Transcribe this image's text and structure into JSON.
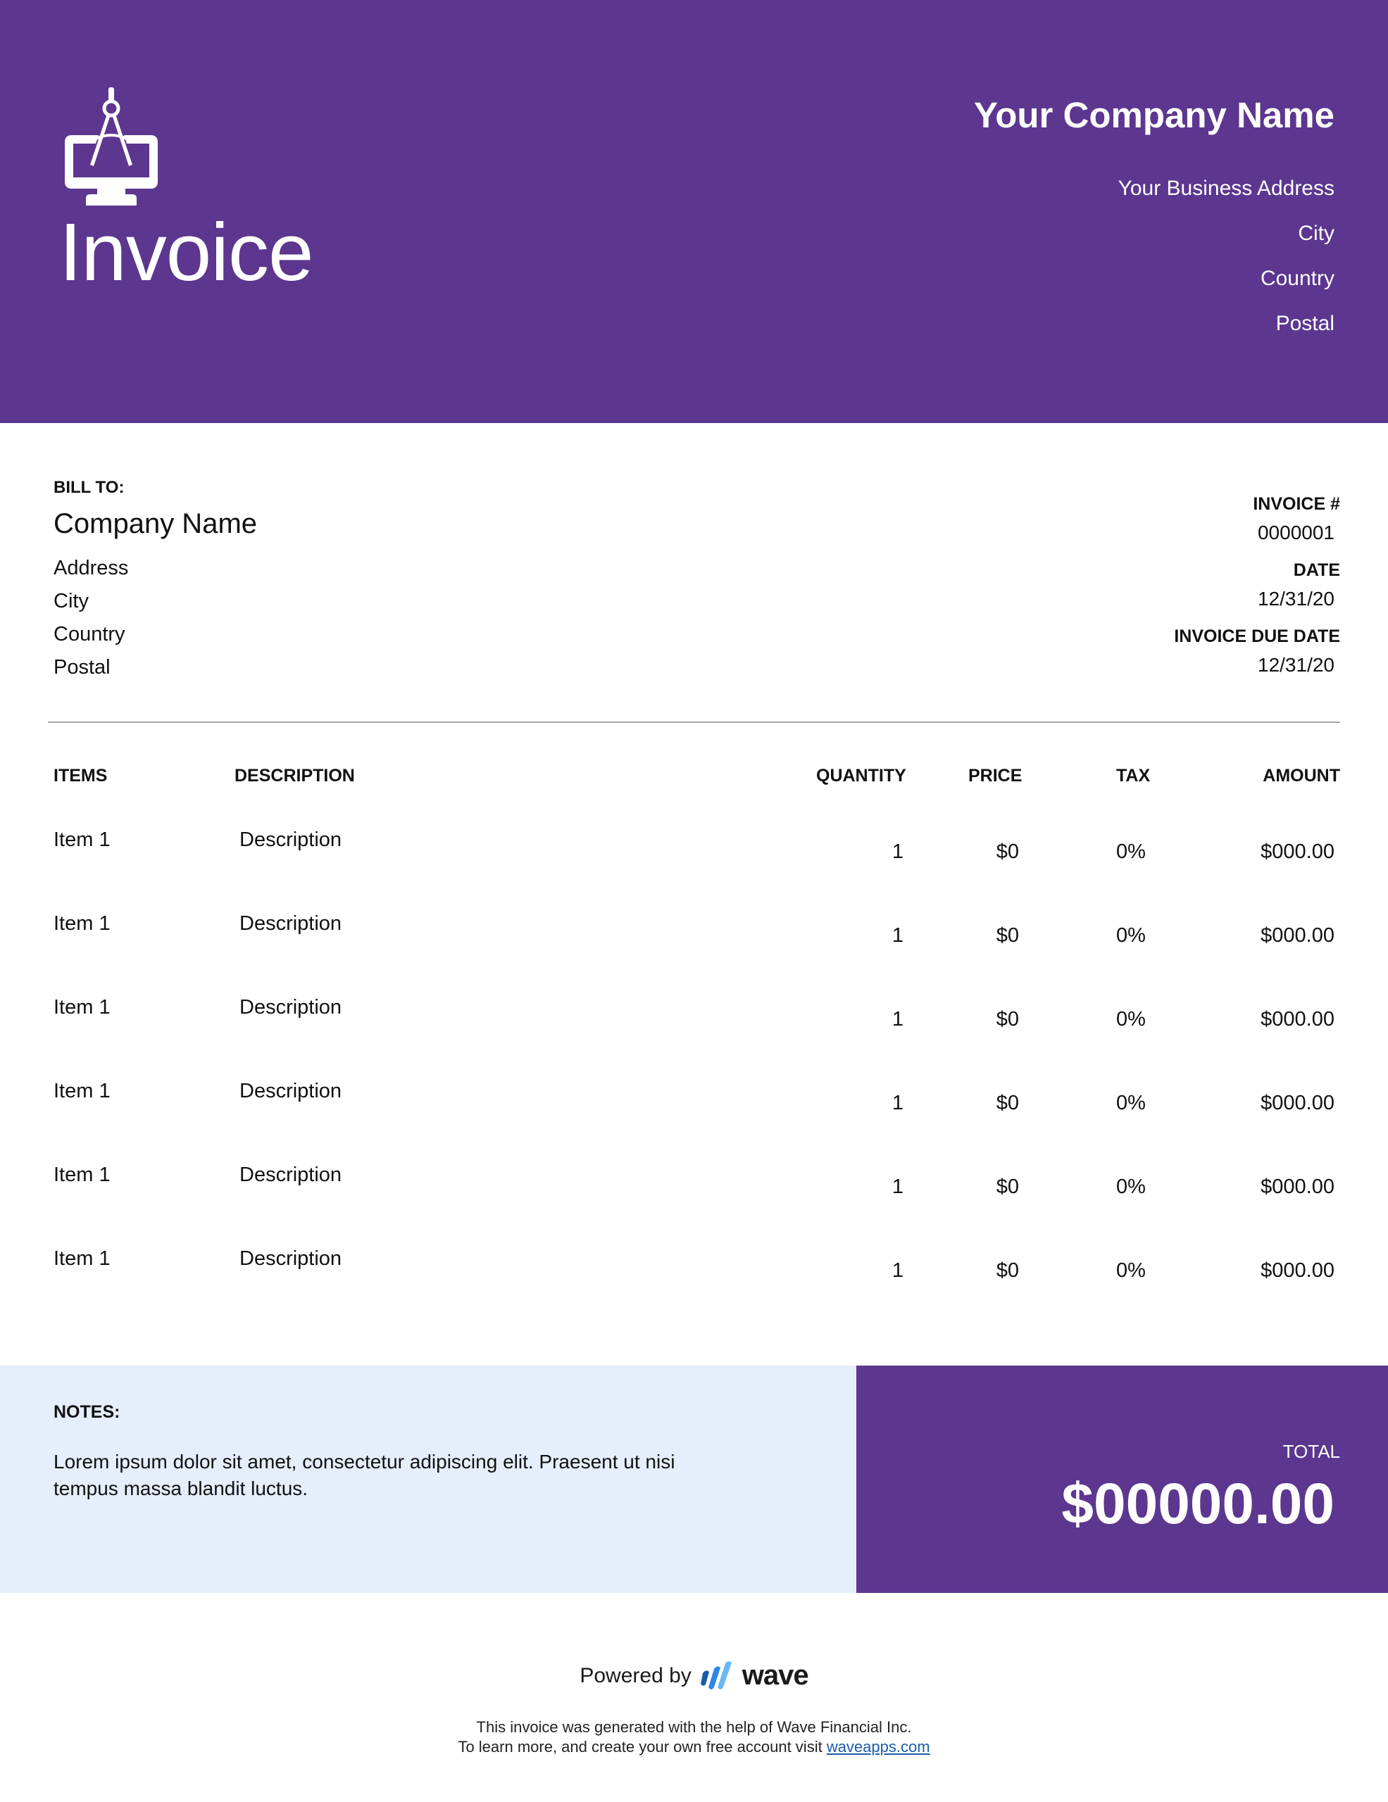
{
  "colors": {
    "brand_purple": "#5c368f",
    "notes_background": "#e6eefc",
    "link": "#1b5cad",
    "wave_blue_dark": "#1b5ca8",
    "wave_blue": "#2e86e6",
    "wave_blue_light": "#6bb8f5"
  },
  "header": {
    "logo_icon": "monitor-with-drafting-compass-icon",
    "title": "Invoice",
    "company": {
      "name": "Your Company Name",
      "address": "Your Business Address",
      "city": "City",
      "country": "Country",
      "postal": "Postal"
    }
  },
  "bill_to": {
    "label": "BILL TO:",
    "company_name": "Company Name",
    "address": "Address",
    "city": "City",
    "country": "Country",
    "postal": "Postal"
  },
  "invoice_meta": {
    "number_label": "INVOICE #",
    "number": "0000001",
    "date_label": "DATE",
    "date": "12/31/20",
    "due_date_label": "INVOICE DUE DATE",
    "due_date": "12/31/20"
  },
  "table": {
    "headers": {
      "items": "ITEMS",
      "description": "DESCRIPTION",
      "quantity": "QUANTITY",
      "price": "PRICE",
      "tax": "TAX",
      "amount": "AMOUNT"
    },
    "rows": [
      {
        "item": "Item 1",
        "description": "Description",
        "quantity": "1",
        "price": "$0",
        "tax": "0%",
        "amount": "$000.00"
      },
      {
        "item": "Item 1",
        "description": "Description",
        "quantity": "1",
        "price": "$0",
        "tax": "0%",
        "amount": "$000.00"
      },
      {
        "item": "Item 1",
        "description": "Description",
        "quantity": "1",
        "price": "$0",
        "tax": "0%",
        "amount": "$000.00"
      },
      {
        "item": "Item 1",
        "description": "Description",
        "quantity": "1",
        "price": "$0",
        "tax": "0%",
        "amount": "$000.00"
      },
      {
        "item": "Item 1",
        "description": "Description",
        "quantity": "1",
        "price": "$0",
        "tax": "0%",
        "amount": "$000.00"
      },
      {
        "item": "Item 1",
        "description": "Description",
        "quantity": "1",
        "price": "$0",
        "tax": "0%",
        "amount": "$000.00"
      }
    ]
  },
  "notes": {
    "label": "NOTES:",
    "text": "Lorem ipsum dolor sit amet, consectetur adipiscing elit. Praesent ut nisi tempus massa blandit luctus."
  },
  "total": {
    "label": "TOTAL",
    "value": "$00000.00"
  },
  "footer": {
    "powered_by": "Powered by",
    "brand_icon": "wave-logo-icon",
    "brand_name": "wave",
    "line1": "This invoice was generated with the help of Wave Financial Inc.",
    "line2_prefix": "To learn more, and create your own free account visit ",
    "link_text": "waveapps.com"
  }
}
